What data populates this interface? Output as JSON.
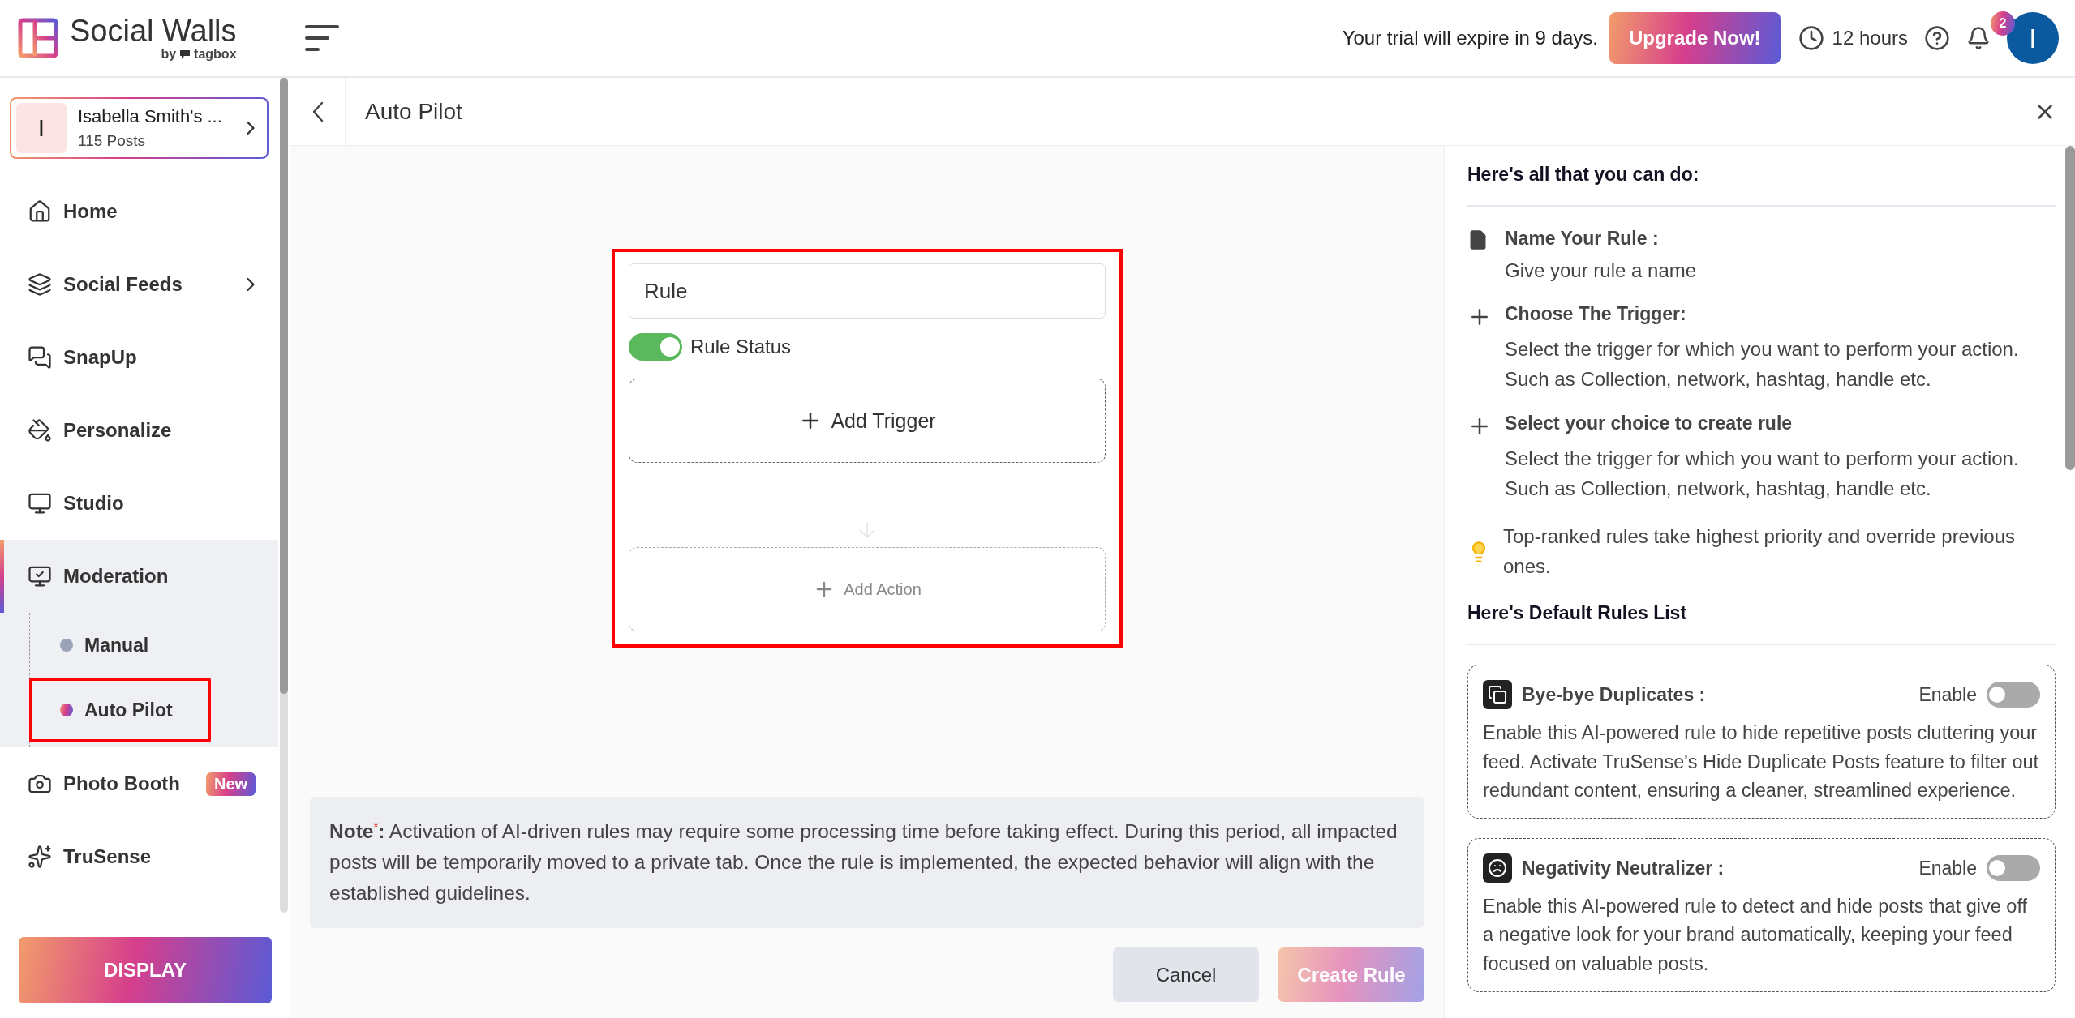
{
  "brand": {
    "name": "Social Walls",
    "byline": "by",
    "partner": "tagbox"
  },
  "topbar": {
    "trial_text": "Your trial will expire in 9 days.",
    "upgrade": "Upgrade Now!",
    "hours": "12 hours",
    "notifications": "2",
    "avatar": "I"
  },
  "account": {
    "initial": "I",
    "name": "Isabella Smith's ...",
    "posts": "115 Posts"
  },
  "nav": [
    {
      "label": "Home",
      "selected": false,
      "has_submenu": false
    },
    {
      "label": "Social Feeds",
      "selected": false,
      "has_submenu": true
    },
    {
      "label": "SnapUp",
      "selected": false,
      "has_submenu": false
    },
    {
      "label": "Personalize",
      "selected": false,
      "has_submenu": false
    },
    {
      "label": "Studio",
      "selected": false,
      "has_submenu": false
    },
    {
      "label": "Moderation",
      "selected": true,
      "has_submenu": false,
      "expanded": true,
      "children": [
        {
          "label": "Manual",
          "selected": false
        },
        {
          "label": "Auto Pilot",
          "selected": true
        }
      ]
    },
    {
      "label": "Photo Booth",
      "selected": false,
      "has_submenu": false,
      "badge": "New"
    },
    {
      "label": "TruSense",
      "selected": false,
      "has_submenu": false
    }
  ],
  "display_button": "DISPLAY",
  "page": {
    "title": "Auto Pilot"
  },
  "rule": {
    "name": "Rule",
    "status_label": "Rule Status",
    "status_on": true,
    "trigger": "Add Trigger",
    "action": "Add Action",
    "action_disabled": true
  },
  "note": "**Note**$^{*}$**:** Activation of AI-driven rules may require some processing time before taking effect. During this period, all impacted posts will be temporarily moved to a private tab. Once the rule is implemented, the expected behavior will align with the established guidelines.",
  "buttons": [
    {
      "label": "Cancel",
      "kind": "secondary",
      "disabled": false
    },
    {
      "label": "Create Rule",
      "kind": "primary",
      "disabled": true
    }
  ],
  "help": {
    "title": "Here's all that you can do:",
    "items": [
      {
        "title": "Name Your Rule :",
        "text": "Give your rule a name"
      },
      {
        "title": "Choose The Trigger:",
        "text": "Select the trigger for which you want to perform your action. Such as Collection, network, hashtag, handle etc."
      },
      {
        "title": "Select your choice to create rule",
        "text": "Select the trigger for which you want to perform your action. Such as Collection, network, hashtag, handle etc."
      }
    ],
    "tip": "Top-ranked rules take highest priority and override previous ones.",
    "rules_title": "Here's Default Rules List",
    "rules": [
      {
        "title": "Bye-bye Duplicates :",
        "toggle_label": "Enable",
        "on": false,
        "text": "Enable this AI-powered rule to hide repetitive posts cluttering your feed. Activate TruSense's Hide Duplicate Posts feature to filter out redundant content, ensuring a cleaner, streamlined experience."
      },
      {
        "title": "Negativity Neutralizer :",
        "toggle_label": "Enable",
        "on": false,
        "text": "Enable this AI-powered rule to detect and hide posts that give off a negative look for your brand automatically, keeping your feed focused on valuable posts."
      }
    ]
  }
}
